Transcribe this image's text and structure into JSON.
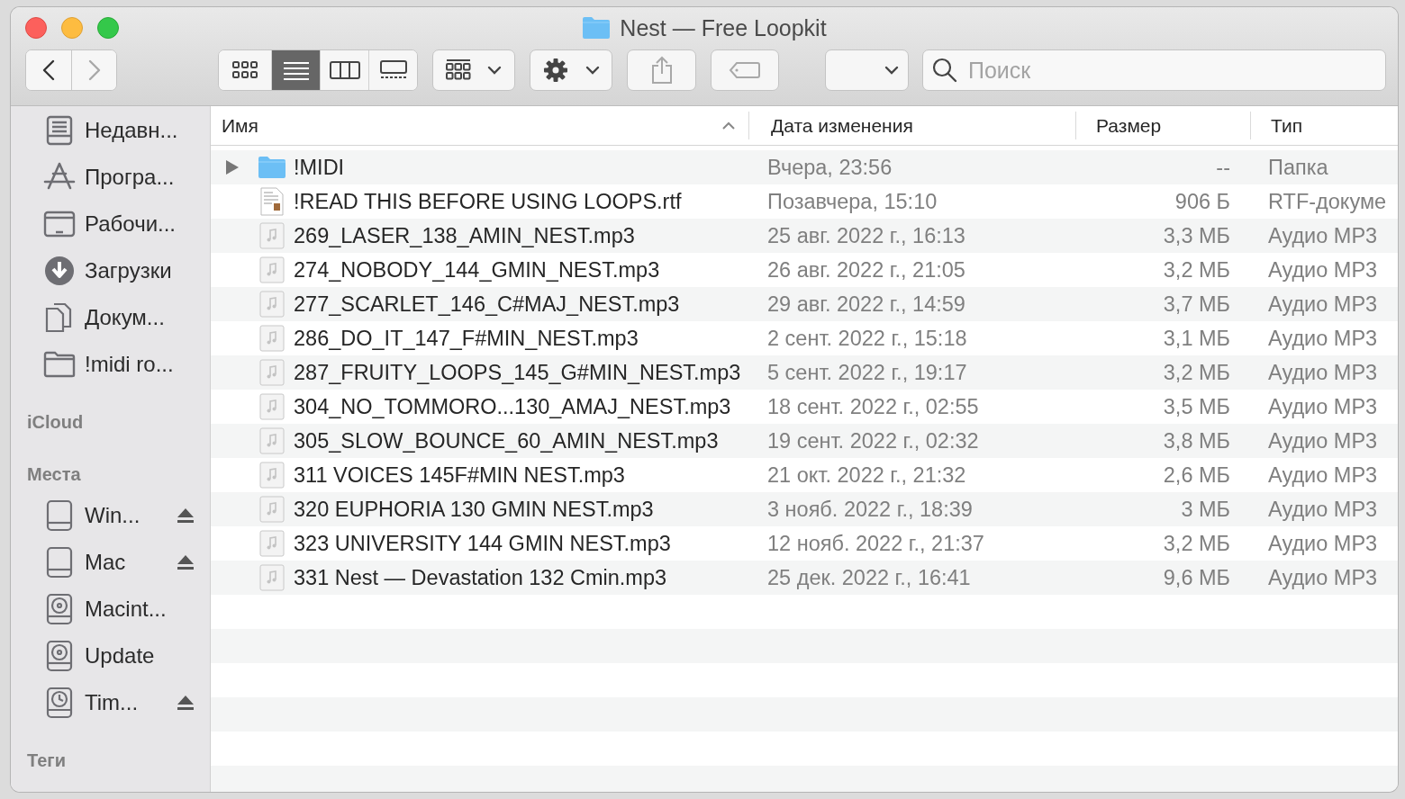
{
  "window": {
    "title": "Nest — Free Loopkit"
  },
  "toolbar": {
    "nav": [
      {
        "kind": "back",
        "disabled": false
      },
      {
        "kind": "forward",
        "disabled": true
      }
    ],
    "views": [
      {
        "kind": "icons",
        "selected": false
      },
      {
        "kind": "list",
        "selected": true
      },
      {
        "kind": "columns",
        "selected": false
      },
      {
        "kind": "gallery",
        "selected": false
      }
    ],
    "search": {
      "placeholder": "Поиск"
    }
  },
  "sidebar": {
    "favorites": [
      {
        "label": "Недавн...",
        "kind": "recents"
      },
      {
        "label": "Програ...",
        "kind": "apps"
      },
      {
        "label": "Рабочи...",
        "kind": "desktop"
      },
      {
        "label": "Загрузки",
        "kind": "downloads"
      },
      {
        "label": "Докум...",
        "kind": "documents"
      },
      {
        "label": "!midi ro...",
        "kind": "folder"
      }
    ],
    "sections": [
      {
        "title": "iCloud"
      },
      {
        "title": "Места",
        "items": [
          {
            "label": "Win...",
            "kind": "drive",
            "eject": true
          },
          {
            "label": "Mac",
            "kind": "drive",
            "eject": true
          },
          {
            "label": "Macint...",
            "kind": "disk",
            "eject": false
          },
          {
            "label": "Update",
            "kind": "disk",
            "eject": false
          },
          {
            "label": "Tim...",
            "kind": "timemachine",
            "eject": true
          }
        ]
      },
      {
        "title": "Теги"
      }
    ]
  },
  "table": {
    "columns": [
      {
        "label": "Имя",
        "sorted": true
      },
      {
        "label": "Дата изменения",
        "sorted": false
      },
      {
        "label": "Размер",
        "sorted": false
      },
      {
        "label": "Тип",
        "sorted": false
      }
    ],
    "rows": [
      {
        "kind": "folder",
        "expanded": false,
        "name": "!MIDI",
        "date": "Вчера, 23:56",
        "size": "--",
        "type": "Папка"
      },
      {
        "kind": "rtf",
        "name": "!READ THIS BEFORE USING LOOPS.rtf",
        "date": "Позавчера, 15:10",
        "size": "906 Б",
        "type": "RTF-докуме"
      },
      {
        "kind": "audio",
        "name": "269_LASER_138_AMIN_NEST.mp3",
        "date": "25 авг. 2022 г., 16:13",
        "size": "3,3 МБ",
        "type": "Аудио MP3"
      },
      {
        "kind": "audio",
        "name": "274_NOBODY_144_GMIN_NEST.mp3",
        "date": "26 авг. 2022 г., 21:05",
        "size": "3,2 МБ",
        "type": "Аудио MP3"
      },
      {
        "kind": "audio",
        "name": "277_SCARLET_146_C#MAJ_NEST.mp3",
        "date": "29 авг. 2022 г., 14:59",
        "size": "3,7 МБ",
        "type": "Аудио MP3"
      },
      {
        "kind": "audio",
        "name": "286_DO_IT_147_F#MIN_NEST.mp3",
        "date": "2 сент. 2022 г., 15:18",
        "size": "3,1 МБ",
        "type": "Аудио MP3"
      },
      {
        "kind": "audio",
        "name": "287_FRUITY_LOOPS_145_G#MIN_NEST.mp3",
        "date": "5 сент. 2022 г., 19:17",
        "size": "3,2 МБ",
        "type": "Аудио MP3"
      },
      {
        "kind": "audio",
        "name": "304_NO_TOMMORO...130_AMAJ_NEST.mp3",
        "date": "18 сент. 2022 г., 02:55",
        "size": "3,5 МБ",
        "type": "Аудио MP3"
      },
      {
        "kind": "audio",
        "name": "305_SLOW_BOUNCE_60_AMIN_NEST.mp3",
        "date": "19 сент. 2022 г., 02:32",
        "size": "3,8 МБ",
        "type": "Аудио MP3"
      },
      {
        "kind": "audio",
        "name": "311 VOICES 145F#MIN NEST.mp3",
        "date": "21 окт. 2022 г., 21:32",
        "size": "2,6 МБ",
        "type": "Аудио MP3"
      },
      {
        "kind": "audio",
        "name": "320 EUPHORIA 130 GMIN NEST.mp3",
        "date": "3 нояб. 2022 г., 18:39",
        "size": "3 МБ",
        "type": "Аудио MP3"
      },
      {
        "kind": "audio",
        "name": "323 UNIVERSITY 144 GMIN NEST.mp3",
        "date": "12 нояб. 2022 г., 21:37",
        "size": "3,2 МБ",
        "type": "Аудио MP3"
      },
      {
        "kind": "audio",
        "name": "331 Nest — Devastation 132 Cmin.mp3",
        "date": "25 дек. 2022 г., 16:41",
        "size": "9,6 МБ",
        "type": "Аудио MP3"
      }
    ]
  }
}
